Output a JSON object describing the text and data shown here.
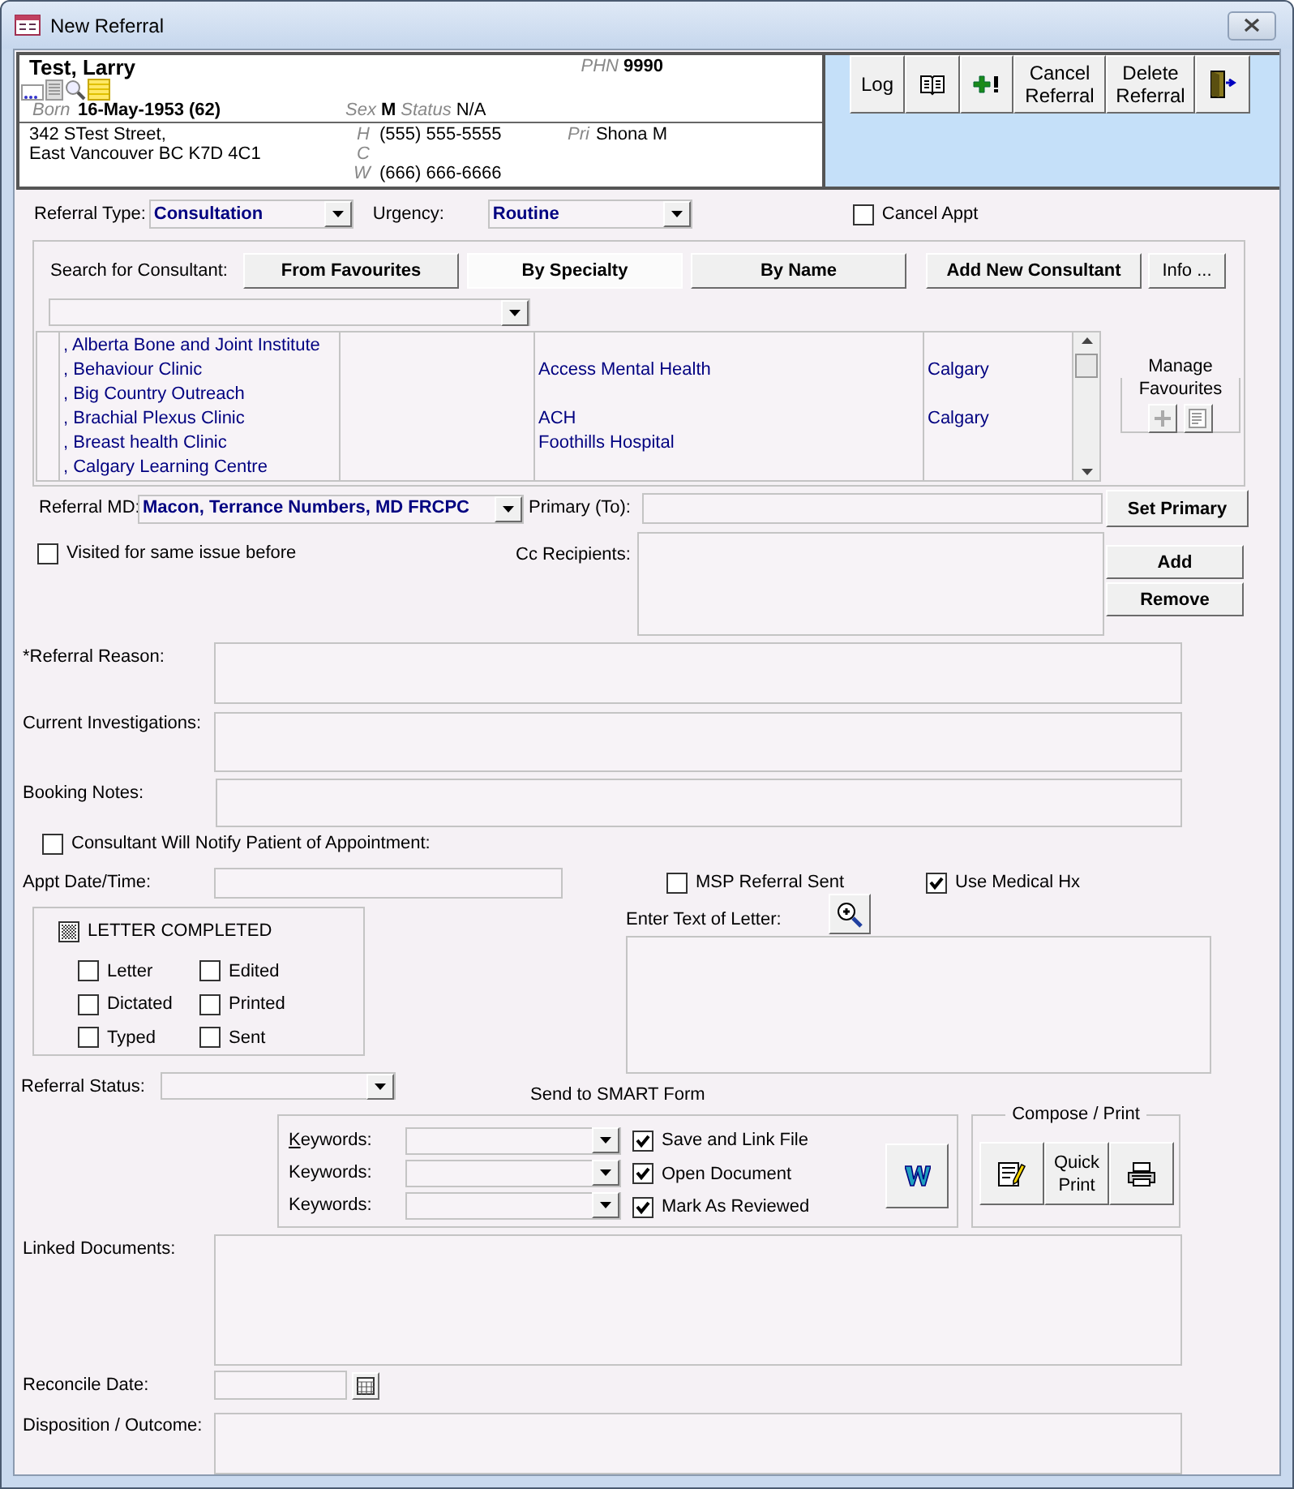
{
  "window": {
    "title": "New Referral"
  },
  "patient": {
    "name": "Test, Larry",
    "phn_label": "PHN",
    "phn": "9990",
    "born_label": "Born",
    "born": "16-May-1953 (62)",
    "sex_label": "Sex",
    "sex": "M",
    "status_label": "Status",
    "status": "N/A",
    "address": [
      "342 STest Street,",
      "East Vancouver BC  K7D 4C1"
    ],
    "phones": [
      {
        "label": "H",
        "number": "(555) 555-5555"
      },
      {
        "label": "C"
      },
      {
        "label": "W",
        "number": "(666) 666-6666"
      }
    ],
    "pri_label": "Pri",
    "pri": "Shona M"
  },
  "toolbar": [
    {
      "kind": "text",
      "label": "Log"
    },
    {
      "kind": "book"
    },
    {
      "kind": "add-alert"
    },
    {
      "kind": "text",
      "label": "Cancel Referral"
    },
    {
      "kind": "text",
      "label": "Delete Referral"
    },
    {
      "kind": "exit"
    }
  ],
  "referral_type": {
    "label": "Referral Type:",
    "value": "Consultation"
  },
  "urgency": {
    "label": "Urgency:",
    "value": "Routine"
  },
  "cancel_appt": {
    "label": "Cancel Appt",
    "checked": false
  },
  "search": {
    "label": "Search for Consultant:",
    "modes": [
      {
        "label": "From Favourites",
        "selected": false
      },
      {
        "label": "By Specialty",
        "selected": true
      },
      {
        "label": "By Name",
        "selected": false
      }
    ],
    "add_button": "Add New Consultant",
    "info_button": "Info ..."
  },
  "consultants": [
    {
      "name": ", Alberta Bone and Joint Institute"
    },
    {
      "name": ", Behaviour Clinic",
      "facility": "Access Mental Health",
      "city": "Calgary"
    },
    {
      "name": ", Big Country Outreach"
    },
    {
      "name": ", Brachial Plexus Clinic",
      "facility": "ACH",
      "city": "Calgary"
    },
    {
      "name": ", Breast health Clinic",
      "facility": "Foothills Hospital"
    },
    {
      "name": ", Calgary Learning Centre"
    }
  ],
  "manage_favourites": {
    "title": "Manage Favourites"
  },
  "referral_md": {
    "label": "Referral MD:",
    "value": "Macon, Terrance Numbers, MD FRCPC"
  },
  "primary": {
    "label": "Primary (To):",
    "button": "Set Primary"
  },
  "visited": {
    "label": "Visited for same issue before",
    "checked": false
  },
  "cc": {
    "label": "Cc Recipients:",
    "add": "Add",
    "remove": "Remove"
  },
  "referral_reason": {
    "label": "*Referral Reason:"
  },
  "current_investigations": {
    "label": "Current Investigations:"
  },
  "booking_notes": {
    "label": "Booking Notes:"
  },
  "consultant_notify": {
    "label": "Consultant Will Notify Patient of Appointment:",
    "checked": false
  },
  "appt": {
    "label": "Appt Date/Time:"
  },
  "msp_sent": {
    "label": "MSP Referral Sent",
    "checked": false
  },
  "use_medical_hx": {
    "label": "Use Medical Hx",
    "checked": true
  },
  "letter_completed": {
    "label": "LETTER COMPLETED",
    "indeterminate": true
  },
  "letter_steps": [
    {
      "label": "Letter",
      "checked": false
    },
    {
      "label": "Edited",
      "checked": false
    },
    {
      "label": "Dictated",
      "checked": false
    },
    {
      "label": "Printed",
      "checked": false
    },
    {
      "label": "Typed",
      "checked": false
    },
    {
      "label": "Sent",
      "checked": false
    }
  ],
  "letter_text": {
    "label": "Enter Text of Letter:"
  },
  "referral_status": {
    "label": "Referral Status:"
  },
  "smart": {
    "title": "Send to SMART Form",
    "keywords": [
      {
        "label": "Keywords:",
        "access_key": true
      },
      {
        "label": "Keywords:",
        "access_key": false
      },
      {
        "label": "Keywords:",
        "access_key": false
      }
    ],
    "options": [
      {
        "label": "Save and Link File",
        "checked": true
      },
      {
        "label": "Open Document",
        "checked": true
      },
      {
        "label": "Mark As Reviewed",
        "checked": true
      }
    ]
  },
  "compose": {
    "title": "Compose / Print",
    "buttons": [
      {
        "kind": "compose"
      },
      {
        "kind": "text",
        "label": "Quick Print"
      },
      {
        "kind": "print"
      }
    ]
  },
  "linked_documents": {
    "label": "Linked Documents:"
  },
  "reconcile_date": {
    "label": "Reconcile Date:"
  },
  "disposition": {
    "label": "Disposition / Outcome:"
  }
}
